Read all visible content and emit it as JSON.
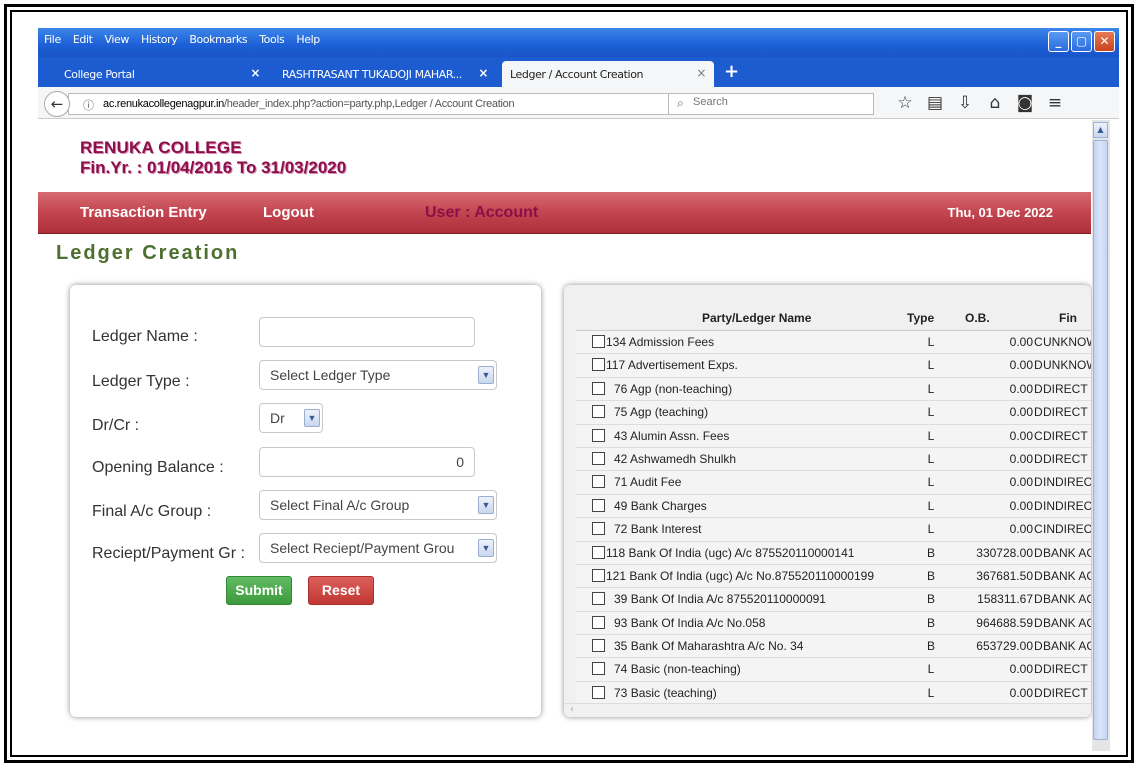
{
  "browser": {
    "menus": [
      "File",
      "Edit",
      "View",
      "History",
      "Bookmarks",
      "Tools",
      "Help"
    ],
    "window_buttons": {
      "minimize": "_",
      "maximize": "▢",
      "close": "✕"
    },
    "tabs": [
      {
        "label": "College Portal",
        "close": "×"
      },
      {
        "label": "RASHTRASANT TUKADOJI MAHAR...",
        "close": "×"
      },
      {
        "label": "Ledger / Account Creation",
        "close": "×"
      }
    ],
    "new_tab": "+",
    "url_host": "ac.renukacollegenagpur.in",
    "url_path": "/header_index.php?action=party.php,Ledger / Account Creation",
    "search_placeholder": "Search"
  },
  "header": {
    "college_name": "RENUKA COLLEGE",
    "fin_year": "Fin.Yr. : 01/04/2016 To 31/03/2020"
  },
  "navbar": {
    "transaction_entry": "Transaction Entry",
    "logout": "Logout",
    "user": "User : Account",
    "date": "Thu, 01 Dec 2022"
  },
  "page_title": "Ledger Creation",
  "form": {
    "ledger_name_label": "Ledger Name :",
    "ledger_name_value": "",
    "ledger_type_label": "Ledger Type :",
    "ledger_type_value": "Select Ledger Type",
    "drcr_label": "Dr/Cr :",
    "drcr_value": "Dr",
    "opening_balance_label": "Opening Balance :",
    "opening_balance_value": "0",
    "final_group_label": "Final A/c Group :",
    "final_group_value": "Select Final A/c Group",
    "receipt_payment_label": "Reciept/Payment Gr :",
    "receipt_payment_value": "Select Reciept/Payment Grou",
    "submit_label": "Submit",
    "reset_label": "Reset"
  },
  "table": {
    "headers": {
      "name": "Party/Ledger Name",
      "type": "Type",
      "ob": "O.B.",
      "group": "Fin"
    },
    "rows": [
      {
        "id": "134",
        "name": "Admission Fees",
        "type": "L",
        "ob": "0.00",
        "dc": "C",
        "group": "UNKNOWN"
      },
      {
        "id": "117",
        "name": "Advertisement Exps.",
        "type": "L",
        "ob": "0.00",
        "dc": "D",
        "group": "UNKNOWN"
      },
      {
        "id": "76",
        "name": "Agp (non-teaching)",
        "type": "L",
        "ob": "0.00",
        "dc": "D",
        "group": "DIRECT EXP"
      },
      {
        "id": "75",
        "name": "Agp (teaching)",
        "type": "L",
        "ob": "0.00",
        "dc": "D",
        "group": "DIRECT EXP"
      },
      {
        "id": "43",
        "name": "Alumin Assn. Fees",
        "type": "L",
        "ob": "0.00",
        "dc": "C",
        "group": "DIRECT INC"
      },
      {
        "id": "42",
        "name": "Ashwamedh Shulkh",
        "type": "L",
        "ob": "0.00",
        "dc": "D",
        "group": "DIRECT INC"
      },
      {
        "id": "71",
        "name": "Audit Fee",
        "type": "L",
        "ob": "0.00",
        "dc": "D",
        "group": "INDIRECT E"
      },
      {
        "id": "49",
        "name": "Bank Charges",
        "type": "L",
        "ob": "0.00",
        "dc": "D",
        "group": "INDIRECT E"
      },
      {
        "id": "72",
        "name": "Bank Interest",
        "type": "L",
        "ob": "0.00",
        "dc": "C",
        "group": "INDIRECT IN"
      },
      {
        "id": "118",
        "name": "Bank Of India (ugc) A/c 875520110000141",
        "type": "B",
        "ob": "330728.00",
        "dc": "D",
        "group": "BANK ACCO"
      },
      {
        "id": "121",
        "name": "Bank Of India (ugc) A/c No.875520110000199",
        "type": "B",
        "ob": "367681.50",
        "dc": "D",
        "group": "BANK ACCO"
      },
      {
        "id": "39",
        "name": "Bank Of India A/c 875520110000091",
        "type": "B",
        "ob": "158311.67",
        "dc": "D",
        "group": "BANK ACCO"
      },
      {
        "id": "93",
        "name": "Bank Of India A/c No.058",
        "type": "B",
        "ob": "964688.59",
        "dc": "D",
        "group": "BANK ACCO"
      },
      {
        "id": "35",
        "name": "Bank Of Maharashtra A/c No. 34",
        "type": "B",
        "ob": "653729.00",
        "dc": "D",
        "group": "BANK ACCO"
      },
      {
        "id": "74",
        "name": "Basic (non-teaching)",
        "type": "L",
        "ob": "0.00",
        "dc": "D",
        "group": "DIRECT EXP"
      },
      {
        "id": "73",
        "name": "Basic (teaching)",
        "type": "L",
        "ob": "0.00",
        "dc": "D",
        "group": "DIRECT EXP"
      }
    ]
  }
}
